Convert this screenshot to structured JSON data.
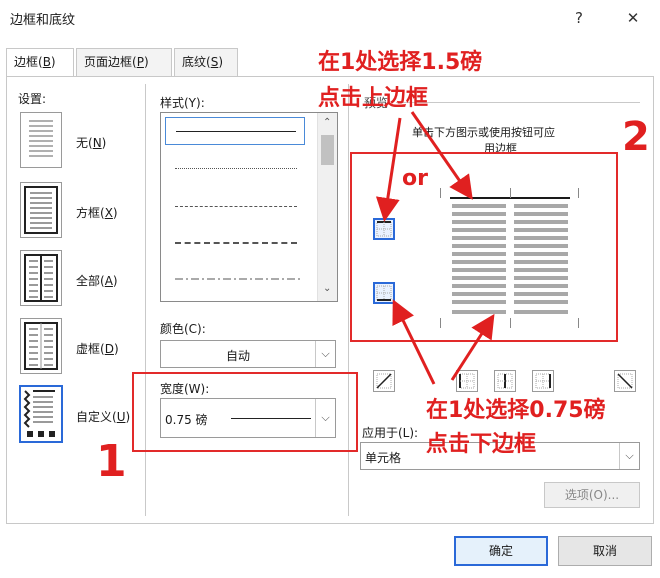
{
  "window": {
    "title": "边框和底纹",
    "help": "?",
    "close": "✕"
  },
  "tabs": [
    {
      "label": "边框(",
      "key": "B",
      "suffix": ")",
      "active": true
    },
    {
      "label": "页面边框(",
      "key": "P",
      "suffix": ")"
    },
    {
      "label": "底纹(",
      "key": "S",
      "suffix": ")"
    }
  ],
  "settings": {
    "heading": "设置:",
    "items": [
      {
        "label": "无(",
        "key": "N",
        "suffix": ")"
      },
      {
        "label": "方框(",
        "key": "X",
        "suffix": ")"
      },
      {
        "label": "全部(",
        "key": "A",
        "suffix": ")"
      },
      {
        "label": "虚框(",
        "key": "D",
        "suffix": ")"
      },
      {
        "label": "自定义(",
        "key": "U",
        "suffix": ")"
      }
    ]
  },
  "style": {
    "heading": "样式(Y):"
  },
  "color": {
    "heading": "颜色(C):",
    "value": "自动"
  },
  "width": {
    "heading": "宽度(W):",
    "value": "0.75 磅"
  },
  "preview": {
    "heading": "预览",
    "hint_line1": "单击下方图示或使用按钮可应",
    "hint_line2": "用边框"
  },
  "apply_to": {
    "heading": "应用于(L):",
    "value": "单元格"
  },
  "buttons": {
    "options": "选项(O)...",
    "ok": "确定",
    "cancel": "取消"
  },
  "annotations": {
    "top_line1": "在1处选择1.5磅",
    "top_line2": "点击上边框",
    "or": "or",
    "num1": "1",
    "num2": "2",
    "bottom_line1": "在1处选择0.75磅",
    "bottom_line2": "点击下边框",
    "color": "#e02020"
  }
}
